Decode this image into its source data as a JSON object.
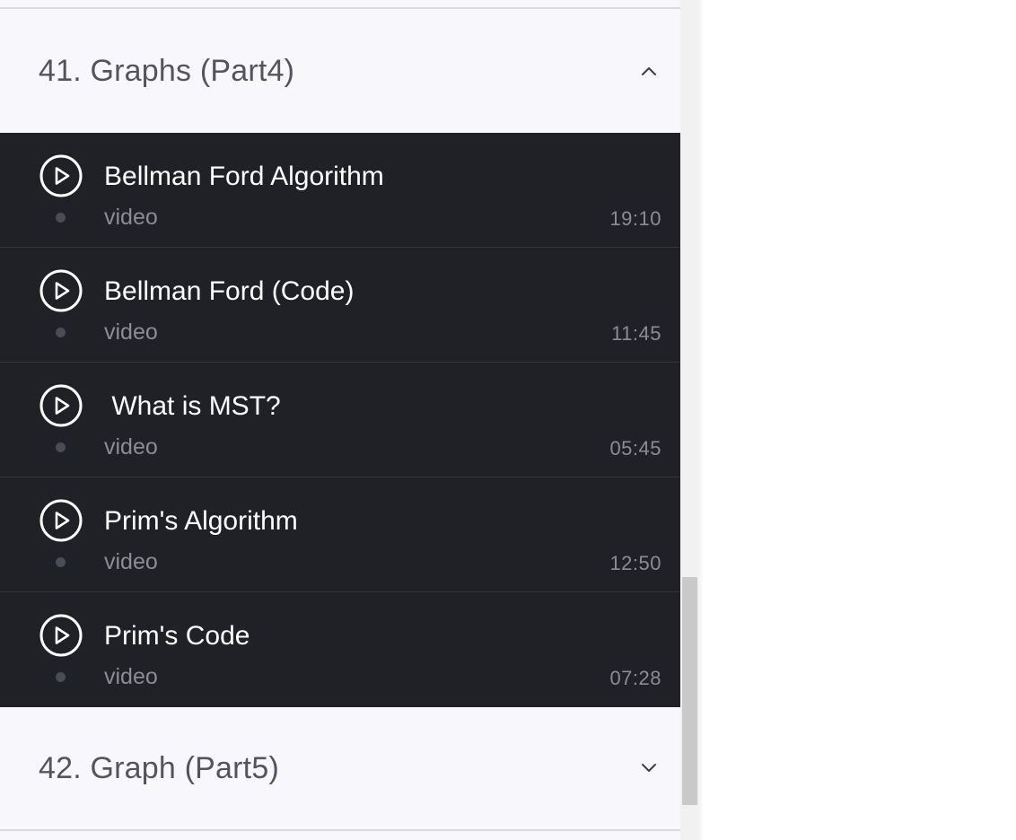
{
  "sections": [
    {
      "title": "41. Graphs (Part4)",
      "expanded": true,
      "chevron_icon": "chevron-up-icon",
      "lessons": [
        {
          "title": "Bellman Ford Algorithm",
          "type": "video",
          "duration": "19:10",
          "icon": "play-circle-icon"
        },
        {
          "title": "Bellman Ford (Code)",
          "type": "video",
          "duration": "11:45",
          "icon": "play-circle-icon"
        },
        {
          "title": " What is MST?",
          "type": "video",
          "duration": "05:45",
          "icon": "play-circle-icon"
        },
        {
          "title": "Prim's Algorithm",
          "type": "video",
          "duration": "12:50",
          "icon": "play-circle-icon"
        },
        {
          "title": "Prim's Code",
          "type": "video",
          "duration": "07:28",
          "icon": "play-circle-icon"
        }
      ]
    },
    {
      "title": "42. Graph (Part5)",
      "expanded": false,
      "chevron_icon": "chevron-down-icon"
    }
  ],
  "colors": {
    "panel_bg": "#f8f7fc",
    "lesson_bg": "#1f2126",
    "lesson_title": "#ffffff",
    "lesson_meta": "#8b8d94",
    "section_title": "#55545e"
  }
}
